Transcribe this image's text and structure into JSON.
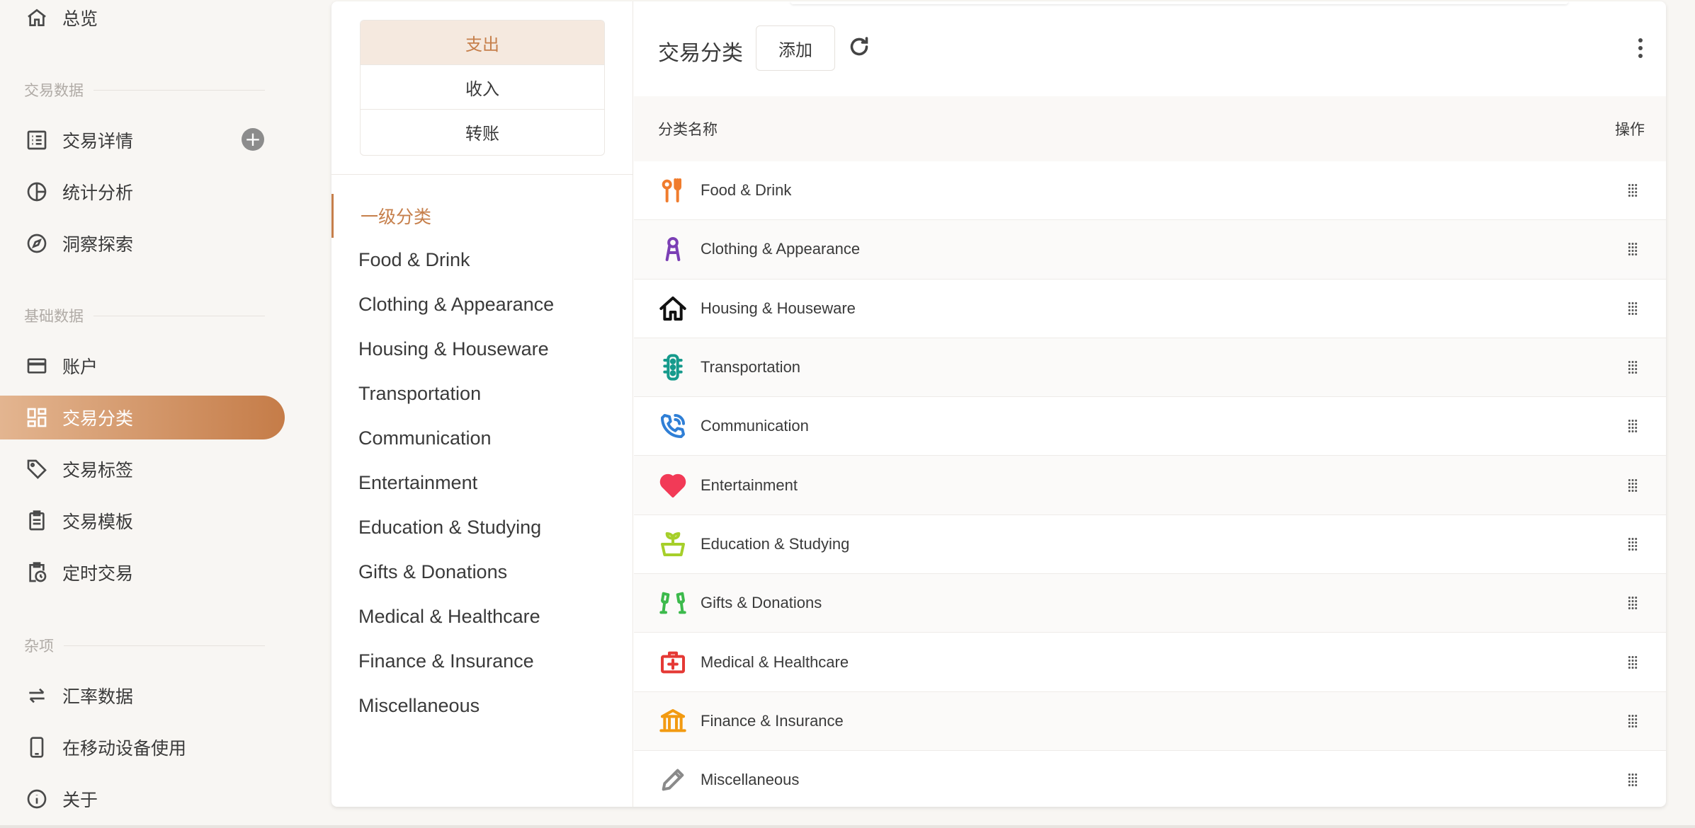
{
  "sidebar": {
    "overview": "总览",
    "section_transactions": "交易数据",
    "transaction_details": "交易详情",
    "statistics": "统计分析",
    "insights": "洞察探索",
    "section_basic": "基础数据",
    "accounts": "账户",
    "categories": "交易分类",
    "tags": "交易标签",
    "templates": "交易模板",
    "scheduled": "定时交易",
    "section_misc": "杂项",
    "exchange_rates": "汇率数据",
    "mobile": "在移动设备使用",
    "about": "关于",
    "add_symbol": "+"
  },
  "type_tabs": [
    "支出",
    "收入",
    "转账"
  ],
  "category_nav": {
    "heading": "一级分类",
    "items": [
      "Food & Drink",
      "Clothing & Appearance",
      "Housing & Houseware",
      "Transportation",
      "Communication",
      "Entertainment",
      "Education & Studying",
      "Gifts & Donations",
      "Medical & Healthcare",
      "Finance & Insurance",
      "Miscellaneous"
    ]
  },
  "toolbar": {
    "title": "交易分类",
    "add_label": "添加"
  },
  "table": {
    "col_name": "分类名称",
    "col_actions": "操作",
    "rows": [
      {
        "name": "Food & Drink",
        "icon": "fork-knife-icon",
        "color": "#f07c2d"
      },
      {
        "name": "Clothing & Appearance",
        "icon": "person-icon",
        "color": "#7b3fb5"
      },
      {
        "name": "Housing & Houseware",
        "icon": "house-icon",
        "color": "#111111"
      },
      {
        "name": "Transportation",
        "icon": "traffic-light-icon",
        "color": "#159a8c"
      },
      {
        "name": "Communication",
        "icon": "phone-ringing-icon",
        "color": "#2f7fd6"
      },
      {
        "name": "Entertainment",
        "icon": "heart-icon",
        "color": "#f23a57"
      },
      {
        "name": "Education & Studying",
        "icon": "plant-box-icon",
        "color": "#a6cf2a"
      },
      {
        "name": "Gifts & Donations",
        "icon": "cheers-glasses-icon",
        "color": "#3cba4c"
      },
      {
        "name": "Medical & Healthcare",
        "icon": "medical-kit-icon",
        "color": "#e53935"
      },
      {
        "name": "Finance & Insurance",
        "icon": "bank-icon",
        "color": "#f29a11"
      },
      {
        "name": "Miscellaneous",
        "icon": "pencil-icon",
        "color": "#8a8a8a"
      }
    ]
  },
  "colors": {
    "accent": "#c67f4b",
    "active_gradient_start": "#e3b590",
    "active_gradient_end": "#c57c48",
    "tab_active_bg": "#f5e9df"
  }
}
